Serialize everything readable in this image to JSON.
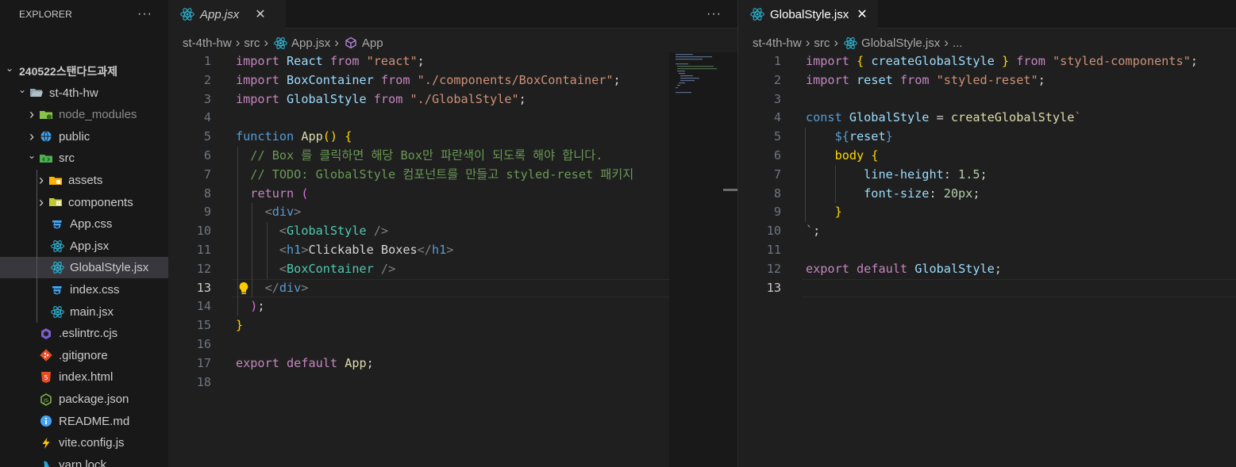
{
  "sidebar": {
    "title": "EXPLORER",
    "more": "···",
    "items": [
      {
        "label": "240522스탠다드과제",
        "icon": "chevron-down-icon",
        "depth": 0,
        "type": "root"
      },
      {
        "label": "st-4th-hw",
        "icon": "folder-open-icon",
        "depth": 1,
        "type": "folder-open"
      },
      {
        "label": "node_modules",
        "icon": "node-folder-icon",
        "depth": 2,
        "type": "folder"
      },
      {
        "label": "public",
        "icon": "public-folder-icon",
        "depth": 2,
        "type": "folder"
      },
      {
        "label": "src",
        "icon": "src-folder-icon",
        "depth": 2,
        "type": "folder-open"
      },
      {
        "label": "assets",
        "icon": "assets-folder-icon",
        "depth": 3,
        "type": "folder"
      },
      {
        "label": "components",
        "icon": "components-folder-icon",
        "depth": 3,
        "type": "folder"
      },
      {
        "label": "App.css",
        "icon": "css-file-icon",
        "depth": 3,
        "type": "file"
      },
      {
        "label": "App.jsx",
        "icon": "react-file-icon",
        "depth": 3,
        "type": "file"
      },
      {
        "label": "GlobalStyle.jsx",
        "icon": "react-file-icon",
        "depth": 3,
        "type": "file",
        "selected": true
      },
      {
        "label": "index.css",
        "icon": "css-file-icon",
        "depth": 3,
        "type": "file"
      },
      {
        "label": "main.jsx",
        "icon": "react-file-icon",
        "depth": 3,
        "type": "file"
      },
      {
        "label": ".eslintrc.cjs",
        "icon": "eslint-file-icon",
        "depth": 2,
        "type": "file"
      },
      {
        "label": ".gitignore",
        "icon": "git-file-icon",
        "depth": 2,
        "type": "file"
      },
      {
        "label": "index.html",
        "icon": "html-file-icon",
        "depth": 2,
        "type": "file"
      },
      {
        "label": "package.json",
        "icon": "nodejs-file-icon",
        "depth": 2,
        "type": "file"
      },
      {
        "label": "README.md",
        "icon": "info-file-icon",
        "depth": 2,
        "type": "file"
      },
      {
        "label": "vite.config.js",
        "icon": "vite-file-icon",
        "depth": 2,
        "type": "file"
      },
      {
        "label": "yarn.lock",
        "icon": "yarn-file-icon",
        "depth": 2,
        "type": "file"
      }
    ]
  },
  "left_editor": {
    "tab": {
      "label": "App.jsx",
      "close": "✕",
      "more": "···"
    },
    "breadcrumb": [
      "st-4th-hw",
      "src",
      "App.jsx",
      "App"
    ],
    "current_line": 13,
    "lines": [
      [
        [
          "k",
          "import"
        ],
        [
          "p",
          " "
        ],
        [
          "v",
          "React"
        ],
        [
          "p",
          " "
        ],
        [
          "k",
          "from"
        ],
        [
          "p",
          " "
        ],
        [
          "s",
          "\"react\""
        ],
        [
          "p",
          ";"
        ]
      ],
      [
        [
          "k",
          "import"
        ],
        [
          "p",
          " "
        ],
        [
          "v",
          "BoxContainer"
        ],
        [
          "p",
          " "
        ],
        [
          "k",
          "from"
        ],
        [
          "p",
          " "
        ],
        [
          "s",
          "\"./components/BoxContainer\""
        ],
        [
          "p",
          ";"
        ]
      ],
      [
        [
          "k",
          "import"
        ],
        [
          "p",
          " "
        ],
        [
          "v",
          "GlobalStyle"
        ],
        [
          "p",
          " "
        ],
        [
          "k",
          "from"
        ],
        [
          "p",
          " "
        ],
        [
          "s",
          "\"./GlobalStyle\""
        ],
        [
          "p",
          ";"
        ]
      ],
      [],
      [
        [
          "kb",
          "function"
        ],
        [
          "p",
          " "
        ],
        [
          "f",
          "App"
        ],
        [
          "b1",
          "()"
        ],
        [
          "p",
          " "
        ],
        [
          "b1",
          "{"
        ]
      ],
      [
        [
          "p",
          "  "
        ],
        [
          "c",
          "// Box 를 클릭하면 해당 Box만 파란색이 되도록 해야 합니다."
        ]
      ],
      [
        [
          "p",
          "  "
        ],
        [
          "c",
          "// TODO: GlobalStyle 컴포넌트를 만들고 styled-reset 패키지"
        ]
      ],
      [
        [
          "p",
          "  "
        ],
        [
          "k",
          "return"
        ],
        [
          "p",
          " "
        ],
        [
          "b2",
          "("
        ]
      ],
      [
        [
          "p",
          "    "
        ],
        [
          "pl",
          "<"
        ],
        [
          "t",
          "div"
        ],
        [
          "pl",
          ">"
        ]
      ],
      [
        [
          "p",
          "      "
        ],
        [
          "pl",
          "<"
        ],
        [
          "comp",
          "GlobalStyle"
        ],
        [
          "p",
          " "
        ],
        [
          "pl",
          "/>"
        ]
      ],
      [
        [
          "p",
          "      "
        ],
        [
          "pl",
          "<"
        ],
        [
          "t",
          "h1"
        ],
        [
          "pl",
          ">"
        ],
        [
          "p",
          "Clickable Boxes"
        ],
        [
          "pl",
          "</"
        ],
        [
          "t",
          "h1"
        ],
        [
          "pl",
          ">"
        ]
      ],
      [
        [
          "p",
          "      "
        ],
        [
          "pl",
          "<"
        ],
        [
          "comp",
          "BoxContainer"
        ],
        [
          "p",
          " "
        ],
        [
          "pl",
          "/>"
        ]
      ],
      [
        [
          "p",
          "    "
        ],
        [
          "pl",
          "</"
        ],
        [
          "t",
          "div"
        ],
        [
          "pl",
          ">"
        ]
      ],
      [
        [
          "p",
          "  "
        ],
        [
          "b2",
          ")"
        ],
        [
          "p",
          ";"
        ]
      ],
      [
        [
          "b1",
          "}"
        ]
      ],
      [],
      [
        [
          "k",
          "export"
        ],
        [
          "p",
          " "
        ],
        [
          "k",
          "default"
        ],
        [
          "p",
          " "
        ],
        [
          "f",
          "App"
        ],
        [
          "p",
          ";"
        ]
      ],
      []
    ]
  },
  "right_editor": {
    "tab": {
      "label": "GlobalStyle.jsx",
      "close": "✕"
    },
    "breadcrumb": [
      "st-4th-hw",
      "src",
      "GlobalStyle.jsx",
      "..."
    ],
    "current_line": 13,
    "lines": [
      [
        [
          "k",
          "import"
        ],
        [
          "p",
          " "
        ],
        [
          "b1",
          "{"
        ],
        [
          "p",
          " "
        ],
        [
          "v",
          "createGlobalStyle"
        ],
        [
          "p",
          " "
        ],
        [
          "b1",
          "}"
        ],
        [
          "p",
          " "
        ],
        [
          "k",
          "from"
        ],
        [
          "p",
          " "
        ],
        [
          "s",
          "\"styled-components\""
        ],
        [
          "p",
          ";"
        ]
      ],
      [
        [
          "k",
          "import"
        ],
        [
          "p",
          " "
        ],
        [
          "v",
          "reset"
        ],
        [
          "p",
          " "
        ],
        [
          "k",
          "from"
        ],
        [
          "p",
          " "
        ],
        [
          "s",
          "\"styled-reset\""
        ],
        [
          "p",
          ";"
        ]
      ],
      [],
      [
        [
          "kb",
          "const"
        ],
        [
          "p",
          " "
        ],
        [
          "v",
          "GlobalStyle"
        ],
        [
          "p",
          " = "
        ],
        [
          "f",
          "createGlobalStyle"
        ],
        [
          "s",
          "`"
        ]
      ],
      [
        [
          "p",
          "    "
        ],
        [
          "kb",
          "${"
        ],
        [
          "v",
          "reset"
        ],
        [
          "kb",
          "}"
        ]
      ],
      [
        [
          "p",
          "    "
        ],
        [
          "b1",
          "body"
        ],
        [
          "p",
          " "
        ],
        [
          "b1",
          "{"
        ]
      ],
      [
        [
          "p",
          "        "
        ],
        [
          "prop",
          "line-height"
        ],
        [
          "p",
          ": "
        ],
        [
          "n",
          "1.5"
        ],
        [
          "p",
          ";"
        ]
      ],
      [
        [
          "p",
          "        "
        ],
        [
          "prop",
          "font-size"
        ],
        [
          "p",
          ": "
        ],
        [
          "n",
          "20px"
        ],
        [
          "p",
          ";"
        ]
      ],
      [
        [
          "p",
          "    "
        ],
        [
          "b1",
          "}"
        ]
      ],
      [
        [
          "s",
          "`"
        ],
        [
          "p",
          ";"
        ]
      ],
      [],
      [
        [
          "k",
          "export"
        ],
        [
          "p",
          " "
        ],
        [
          "k",
          "default"
        ],
        [
          "p",
          " "
        ],
        [
          "v",
          "GlobalStyle"
        ],
        [
          "p",
          ";"
        ]
      ],
      []
    ]
  },
  "colors": {
    "background": "#1f1f1f",
    "sidebar": "#181818",
    "selection": "#37373d",
    "react_icon": "#2bb5d4",
    "css_icon": "#42a5f5"
  }
}
